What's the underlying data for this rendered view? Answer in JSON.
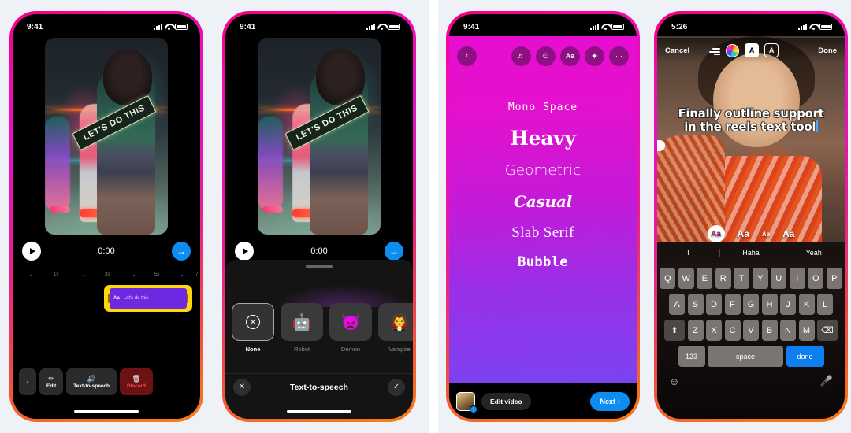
{
  "canvas": {
    "background": "#eef1f6",
    "divider_color": "#ffffff"
  },
  "phones": {
    "phone1": {
      "status": {
        "time": "9:41"
      },
      "video": {
        "overlay_text": "LET'S DO THIS"
      },
      "transport": {
        "timecode": "0:00",
        "play_icon": "play-icon",
        "next_icon": "→"
      },
      "timeline": {
        "ticks": [
          "1s",
          "3s",
          "5s",
          "7"
        ],
        "clip": {
          "icon_label": "Aa",
          "text": "Let's do this",
          "color": "#6d28e0",
          "handle_color": "#ffd60a"
        }
      },
      "actions": {
        "back_icon": "‹",
        "items": [
          {
            "label": "Edit",
            "icon": "pencil-icon",
            "glyph": "✏"
          },
          {
            "label": "Text-to-speech",
            "icon": "speaker-icon",
            "glyph": "🔊"
          },
          {
            "label": "Discard",
            "icon": "trash-icon",
            "glyph": "🗑"
          }
        ]
      }
    },
    "phone2": {
      "status": {
        "time": "9:41"
      },
      "video": {
        "overlay_text": "LET'S DO THIS"
      },
      "transport": {
        "timecode": "0:00"
      },
      "sheet": {
        "title": "Text-to-speech",
        "close_icon": "✕",
        "confirm_icon": "✓",
        "voices": [
          {
            "label": "None",
            "glyph": "",
            "icon": "none-circle-icon",
            "selected": true
          },
          {
            "label": "Robot",
            "glyph": "🤖",
            "icon": "robot-icon",
            "selected": false
          },
          {
            "label": "Demon",
            "glyph": "👿",
            "icon": "demon-icon",
            "selected": false
          },
          {
            "label": "Vampire",
            "glyph": "🧛",
            "icon": "vampire-icon",
            "selected": false
          }
        ]
      }
    },
    "phone3": {
      "status": {
        "time": "9:41"
      },
      "toolbar": {
        "back_icon": "‹",
        "icons": [
          {
            "name": "music-icon",
            "glyph": "♬"
          },
          {
            "name": "sticker-icon",
            "glyph": "☺"
          },
          {
            "name": "text-icon",
            "glyph": "Aa"
          },
          {
            "name": "effects-icon",
            "glyph": "✦"
          },
          {
            "name": "more-icon",
            "glyph": "···"
          }
        ]
      },
      "fonts": [
        {
          "name": "Mono Space",
          "style": "f-mono"
        },
        {
          "name": "Heavy",
          "style": "f-heavy"
        },
        {
          "name": "Geometric",
          "style": "f-geo"
        },
        {
          "name": "Casual",
          "style": "f-casual"
        },
        {
          "name": "Slab Serif",
          "style": "f-slab"
        },
        {
          "name": "Bubble",
          "style": "f-bubble"
        }
      ],
      "bottom": {
        "avatar_badge": "+",
        "edit_video_label": "Edit video",
        "next_label": "Next",
        "next_chevron": "›"
      },
      "gradient": {
        "from": "#e70ed0",
        "to": "#7b43f2"
      }
    },
    "phone4": {
      "status": {
        "time": "5:26"
      },
      "header": {
        "cancel_label": "Cancel",
        "done_label": "Done",
        "icons": [
          {
            "name": "align-icon",
            "glyph": ""
          },
          {
            "name": "color-wheel-icon",
            "glyph": ""
          },
          {
            "name": "text-effect-icon",
            "glyph": "A"
          },
          {
            "name": "text-outline-icon",
            "glyph": "A"
          }
        ]
      },
      "overlay": {
        "line1": "Finally outline support",
        "line2": "in the reels text tool"
      },
      "style_options": [
        {
          "label": "Aa",
          "selected": true
        },
        {
          "label": "Aa",
          "selected": false
        },
        {
          "label": "Aa",
          "selected": false
        },
        {
          "label": "Aa",
          "selected": false
        }
      ],
      "suggestions": [
        "I",
        "Haha",
        "Yeah"
      ],
      "keyboard": {
        "row1": [
          "Q",
          "W",
          "E",
          "R",
          "T",
          "Y",
          "U",
          "I",
          "O",
          "P"
        ],
        "row2": [
          "A",
          "S",
          "D",
          "F",
          "G",
          "H",
          "J",
          "K",
          "L"
        ],
        "row3": [
          "Z",
          "X",
          "C",
          "V",
          "B",
          "N",
          "M"
        ],
        "shift_icon": "⬆",
        "backspace_icon": "⌫",
        "numbers_label": "123",
        "space_label": "space",
        "done_label": "done",
        "emoji_icon": "☺",
        "mic_icon": "🎤"
      }
    }
  }
}
